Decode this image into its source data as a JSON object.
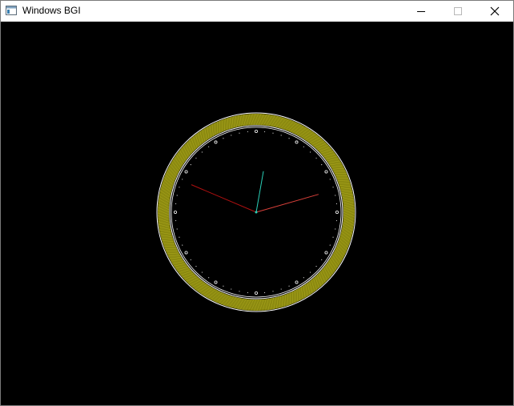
{
  "window": {
    "title": "Windows BGI",
    "icon": "window-app-icon",
    "controls": {
      "minimize_icon": "minimize-icon",
      "maximize_icon": "maximize-icon",
      "close_icon": "close-icon"
    }
  },
  "canvas": {
    "background": "#000000"
  },
  "clock": {
    "time": {
      "hours": 2,
      "minutes": 2,
      "seconds": 45
    },
    "colors": {
      "rim_fill": "#8c8a10",
      "rim_hatch": "#c8c22a",
      "rim_outline": "#ffffff",
      "hour_markers": "#ffffff",
      "minute_dots": "#cfcfcf",
      "hour_hand": "#2ad0b8",
      "minute_hand": "#d8403a",
      "second_hand": "#b01010"
    }
  }
}
